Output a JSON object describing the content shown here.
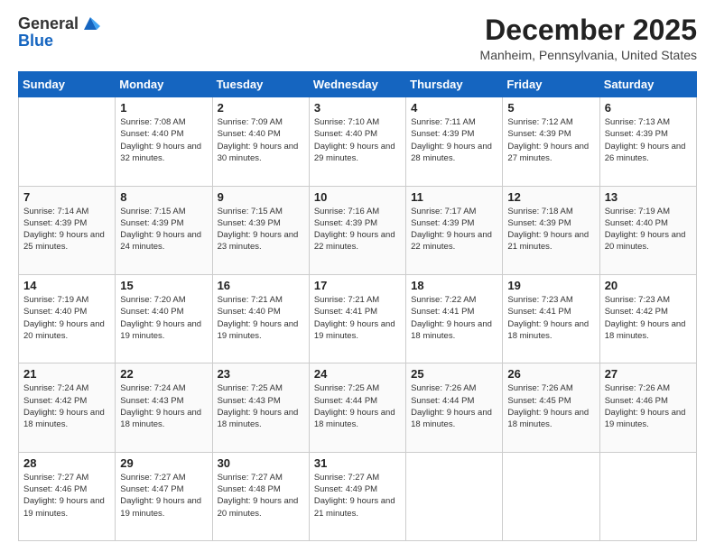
{
  "header": {
    "logo": {
      "line1": "General",
      "line2": "Blue"
    },
    "title": "December 2025",
    "location": "Manheim, Pennsylvania, United States"
  },
  "days_of_week": [
    "Sunday",
    "Monday",
    "Tuesday",
    "Wednesday",
    "Thursday",
    "Friday",
    "Saturday"
  ],
  "weeks": [
    [
      {
        "day": "",
        "sunrise": "",
        "sunset": "",
        "daylight": ""
      },
      {
        "day": "1",
        "sunrise": "Sunrise: 7:08 AM",
        "sunset": "Sunset: 4:40 PM",
        "daylight": "Daylight: 9 hours and 32 minutes."
      },
      {
        "day": "2",
        "sunrise": "Sunrise: 7:09 AM",
        "sunset": "Sunset: 4:40 PM",
        "daylight": "Daylight: 9 hours and 30 minutes."
      },
      {
        "day": "3",
        "sunrise": "Sunrise: 7:10 AM",
        "sunset": "Sunset: 4:40 PM",
        "daylight": "Daylight: 9 hours and 29 minutes."
      },
      {
        "day": "4",
        "sunrise": "Sunrise: 7:11 AM",
        "sunset": "Sunset: 4:39 PM",
        "daylight": "Daylight: 9 hours and 28 minutes."
      },
      {
        "day": "5",
        "sunrise": "Sunrise: 7:12 AM",
        "sunset": "Sunset: 4:39 PM",
        "daylight": "Daylight: 9 hours and 27 minutes."
      },
      {
        "day": "6",
        "sunrise": "Sunrise: 7:13 AM",
        "sunset": "Sunset: 4:39 PM",
        "daylight": "Daylight: 9 hours and 26 minutes."
      }
    ],
    [
      {
        "day": "7",
        "sunrise": "Sunrise: 7:14 AM",
        "sunset": "Sunset: 4:39 PM",
        "daylight": "Daylight: 9 hours and 25 minutes."
      },
      {
        "day": "8",
        "sunrise": "Sunrise: 7:15 AM",
        "sunset": "Sunset: 4:39 PM",
        "daylight": "Daylight: 9 hours and 24 minutes."
      },
      {
        "day": "9",
        "sunrise": "Sunrise: 7:15 AM",
        "sunset": "Sunset: 4:39 PM",
        "daylight": "Daylight: 9 hours and 23 minutes."
      },
      {
        "day": "10",
        "sunrise": "Sunrise: 7:16 AM",
        "sunset": "Sunset: 4:39 PM",
        "daylight": "Daylight: 9 hours and 22 minutes."
      },
      {
        "day": "11",
        "sunrise": "Sunrise: 7:17 AM",
        "sunset": "Sunset: 4:39 PM",
        "daylight": "Daylight: 9 hours and 22 minutes."
      },
      {
        "day": "12",
        "sunrise": "Sunrise: 7:18 AM",
        "sunset": "Sunset: 4:39 PM",
        "daylight": "Daylight: 9 hours and 21 minutes."
      },
      {
        "day": "13",
        "sunrise": "Sunrise: 7:19 AM",
        "sunset": "Sunset: 4:40 PM",
        "daylight": "Daylight: 9 hours and 20 minutes."
      }
    ],
    [
      {
        "day": "14",
        "sunrise": "Sunrise: 7:19 AM",
        "sunset": "Sunset: 4:40 PM",
        "daylight": "Daylight: 9 hours and 20 minutes."
      },
      {
        "day": "15",
        "sunrise": "Sunrise: 7:20 AM",
        "sunset": "Sunset: 4:40 PM",
        "daylight": "Daylight: 9 hours and 19 minutes."
      },
      {
        "day": "16",
        "sunrise": "Sunrise: 7:21 AM",
        "sunset": "Sunset: 4:40 PM",
        "daylight": "Daylight: 9 hours and 19 minutes."
      },
      {
        "day": "17",
        "sunrise": "Sunrise: 7:21 AM",
        "sunset": "Sunset: 4:41 PM",
        "daylight": "Daylight: 9 hours and 19 minutes."
      },
      {
        "day": "18",
        "sunrise": "Sunrise: 7:22 AM",
        "sunset": "Sunset: 4:41 PM",
        "daylight": "Daylight: 9 hours and 18 minutes."
      },
      {
        "day": "19",
        "sunrise": "Sunrise: 7:23 AM",
        "sunset": "Sunset: 4:41 PM",
        "daylight": "Daylight: 9 hours and 18 minutes."
      },
      {
        "day": "20",
        "sunrise": "Sunrise: 7:23 AM",
        "sunset": "Sunset: 4:42 PM",
        "daylight": "Daylight: 9 hours and 18 minutes."
      }
    ],
    [
      {
        "day": "21",
        "sunrise": "Sunrise: 7:24 AM",
        "sunset": "Sunset: 4:42 PM",
        "daylight": "Daylight: 9 hours and 18 minutes."
      },
      {
        "day": "22",
        "sunrise": "Sunrise: 7:24 AM",
        "sunset": "Sunset: 4:43 PM",
        "daylight": "Daylight: 9 hours and 18 minutes."
      },
      {
        "day": "23",
        "sunrise": "Sunrise: 7:25 AM",
        "sunset": "Sunset: 4:43 PM",
        "daylight": "Daylight: 9 hours and 18 minutes."
      },
      {
        "day": "24",
        "sunrise": "Sunrise: 7:25 AM",
        "sunset": "Sunset: 4:44 PM",
        "daylight": "Daylight: 9 hours and 18 minutes."
      },
      {
        "day": "25",
        "sunrise": "Sunrise: 7:26 AM",
        "sunset": "Sunset: 4:44 PM",
        "daylight": "Daylight: 9 hours and 18 minutes."
      },
      {
        "day": "26",
        "sunrise": "Sunrise: 7:26 AM",
        "sunset": "Sunset: 4:45 PM",
        "daylight": "Daylight: 9 hours and 18 minutes."
      },
      {
        "day": "27",
        "sunrise": "Sunrise: 7:26 AM",
        "sunset": "Sunset: 4:46 PM",
        "daylight": "Daylight: 9 hours and 19 minutes."
      }
    ],
    [
      {
        "day": "28",
        "sunrise": "Sunrise: 7:27 AM",
        "sunset": "Sunset: 4:46 PM",
        "daylight": "Daylight: 9 hours and 19 minutes."
      },
      {
        "day": "29",
        "sunrise": "Sunrise: 7:27 AM",
        "sunset": "Sunset: 4:47 PM",
        "daylight": "Daylight: 9 hours and 19 minutes."
      },
      {
        "day": "30",
        "sunrise": "Sunrise: 7:27 AM",
        "sunset": "Sunset: 4:48 PM",
        "daylight": "Daylight: 9 hours and 20 minutes."
      },
      {
        "day": "31",
        "sunrise": "Sunrise: 7:27 AM",
        "sunset": "Sunset: 4:49 PM",
        "daylight": "Daylight: 9 hours and 21 minutes."
      },
      {
        "day": "",
        "sunrise": "",
        "sunset": "",
        "daylight": ""
      },
      {
        "day": "",
        "sunrise": "",
        "sunset": "",
        "daylight": ""
      },
      {
        "day": "",
        "sunrise": "",
        "sunset": "",
        "daylight": ""
      }
    ]
  ]
}
